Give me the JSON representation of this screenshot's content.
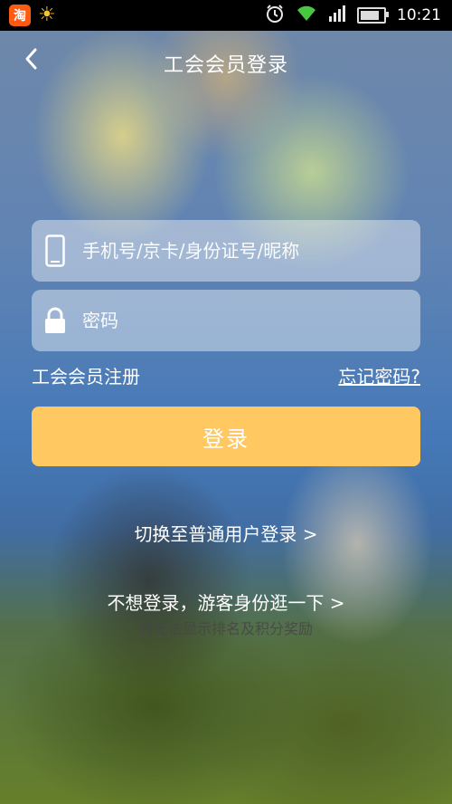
{
  "status_bar": {
    "app_icon_text": "淘",
    "weather_icon": "sun-icon",
    "time": "10:21",
    "icons": [
      "alarm-icon",
      "wifi-icon",
      "signal-icon",
      "battery-icon"
    ]
  },
  "header": {
    "title": "工会会员登录",
    "back_icon": "chevron-left-icon"
  },
  "form": {
    "account_placeholder": "手机号/京卡/身份证号/昵称",
    "account_value": "",
    "password_placeholder": "密码",
    "password_value": "",
    "register_label": "工会会员注册",
    "forgot_label": "忘记密码?",
    "login_label": "登录"
  },
  "alternate": {
    "switch_label": "切换至普通用户登录 >",
    "guest_label": "不想登录，游客身份逛一下 >",
    "guest_note": "将无法显示排名及积分奖励"
  },
  "colors": {
    "login_button": "#ffc861",
    "status_bar": "#000000"
  }
}
